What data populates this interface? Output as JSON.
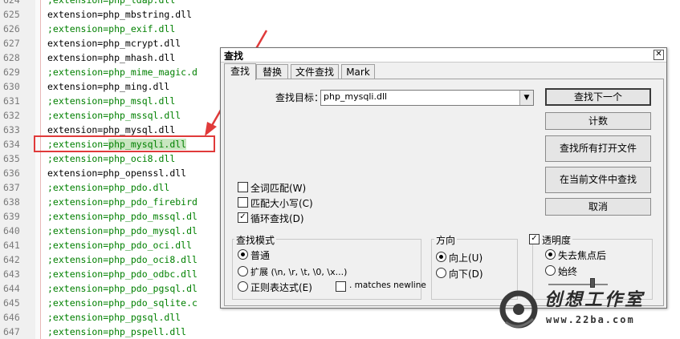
{
  "editor": {
    "lines": [
      {
        "num": "624",
        "text": ";extension=php_ldap.dll",
        "kind": "comment"
      },
      {
        "num": "625",
        "text": "extension=php_mbstring.dll",
        "kind": "normal"
      },
      {
        "num": "626",
        "text": ";extension=php_exif.dll",
        "kind": "comment"
      },
      {
        "num": "627",
        "text": "extension=php_mcrypt.dll",
        "kind": "normal"
      },
      {
        "num": "628",
        "text": "extension=php_mhash.dll",
        "kind": "normal"
      },
      {
        "num": "629",
        "text": ";extension=php_mime_magic.d",
        "kind": "comment"
      },
      {
        "num": "630",
        "text": "extension=php_ming.dll",
        "kind": "normal"
      },
      {
        "num": "631",
        "text": ";extension=php_msql.dll",
        "kind": "comment"
      },
      {
        "num": "632",
        "text": ";extension=php_mssql.dll",
        "kind": "comment"
      },
      {
        "num": "633",
        "text": "extension=php_mysql.dll",
        "kind": "normal"
      },
      {
        "num": "634",
        "text": ";extension=php_mysqli.dll",
        "kind": "comment",
        "match_prefix": ";extension=",
        "match": "php_mysqli.dll"
      },
      {
        "num": "635",
        "text": ";extension=php_oci8.dll",
        "kind": "comment"
      },
      {
        "num": "636",
        "text": "extension=php_openssl.dll",
        "kind": "normal"
      },
      {
        "num": "637",
        "text": ";extension=php_pdo.dll",
        "kind": "comment"
      },
      {
        "num": "638",
        "text": ";extension=php_pdo_firebird",
        "kind": "comment"
      },
      {
        "num": "639",
        "text": ";extension=php_pdo_mssql.dl",
        "kind": "comment"
      },
      {
        "num": "640",
        "text": ";extension=php_pdo_mysql.dl",
        "kind": "comment"
      },
      {
        "num": "641",
        "text": ";extension=php_pdo_oci.dll",
        "kind": "comment"
      },
      {
        "num": "642",
        "text": ";extension=php_pdo_oci8.dll",
        "kind": "comment"
      },
      {
        "num": "643",
        "text": ";extension=php_pdo_odbc.dll",
        "kind": "comment"
      },
      {
        "num": "644",
        "text": ";extension=php_pdo_pgsql.dl",
        "kind": "comment"
      },
      {
        "num": "645",
        "text": ";extension=php_pdo_sqlite.c",
        "kind": "comment"
      },
      {
        "num": "646",
        "text": ";extension=php_pgsql.dll",
        "kind": "comment"
      },
      {
        "num": "647",
        "text": ";extension=php_pspell.dll",
        "kind": "comment"
      }
    ]
  },
  "dialog": {
    "title": "查找",
    "close_glyph": "✕",
    "tabs": [
      {
        "label": "查找",
        "active": true
      },
      {
        "label": "替换",
        "active": false
      },
      {
        "label": "文件查找",
        "active": false
      },
      {
        "label": "Mark",
        "active": false
      }
    ],
    "find_label": "查找目标：",
    "find_value": "php_mysqli.dll",
    "buttons": {
      "find_next": "查找下一个",
      "count": "计数",
      "find_all_open": "查找所有打开文件",
      "find_current": "在当前文件中查找",
      "cancel": "取消"
    },
    "options": {
      "whole_word": {
        "label": "全词匹配(W)",
        "checked": false
      },
      "match_case": {
        "label": "匹配大小写(C)",
        "checked": false
      },
      "wrap": {
        "label": "循环查找(D)",
        "checked": true
      }
    },
    "search_mode": {
      "label": "查找模式",
      "normal": {
        "label": "普通",
        "selected": true
      },
      "extended": {
        "label": "扩展 (\\n, \\r, \\t, \\0, \\x...)",
        "selected": false
      },
      "regex": {
        "label": "正则表达式(E)",
        "selected": false
      },
      "matches_newline": {
        "label": ". matches newline",
        "checked": false
      }
    },
    "direction": {
      "label": "方向",
      "up": {
        "label": "向上(U)",
        "selected": true
      },
      "down": {
        "label": "向下(D)",
        "selected": false
      }
    },
    "transparency": {
      "label": "透明度",
      "checked": true,
      "on_lose_focus": {
        "label": "失去焦点后",
        "selected": true
      },
      "always": {
        "label": "始终",
        "selected": false
      },
      "level": 0.7
    }
  },
  "watermark": {
    "name": "创想工作室",
    "url": "www.22ba.com"
  },
  "colors": {
    "comment": "#008000",
    "normal": "#000000",
    "match_highlight": "#c8e6c0",
    "annotation_red": "#e03a3a"
  }
}
